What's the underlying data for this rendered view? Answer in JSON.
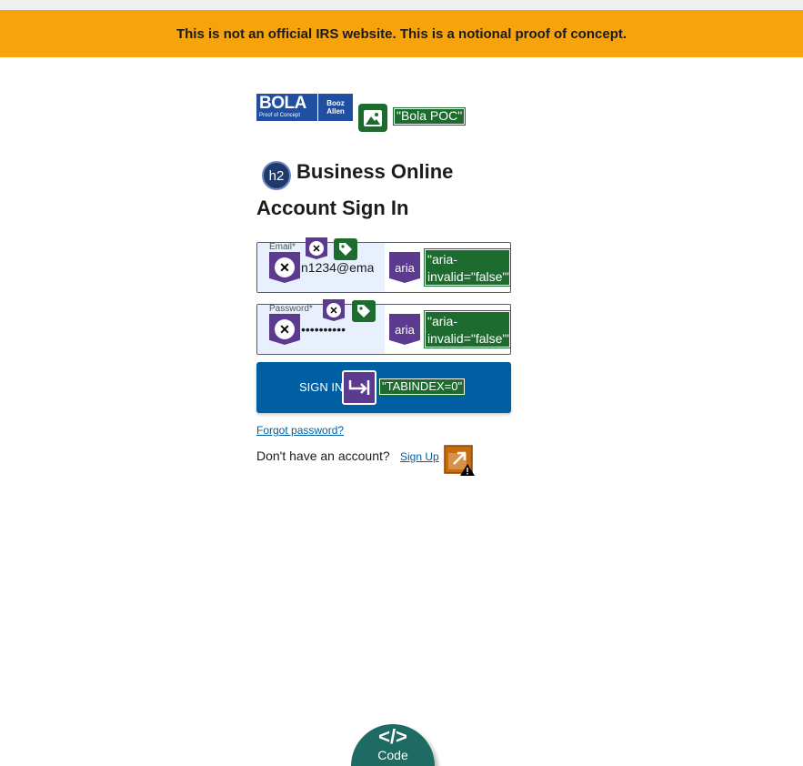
{
  "banner": {
    "text": "This is not an official IRS website. This is a notional proof of concept."
  },
  "logo": {
    "brand": "BOLA",
    "tagline": "Proof of Concept",
    "partner_line1": "Booz",
    "partner_line2": "Allen"
  },
  "logo_alt_tag": "\"Bola POC\"",
  "heading_badge": "h2",
  "app_title": "Business Online",
  "page_title": "Account Sign In",
  "email": {
    "label": "Email",
    "required_mark": "*",
    "value": "n1234@ema",
    "aria_badge": "aria",
    "aria_tag": "\"aria-invalid=\"false\"\""
  },
  "password": {
    "label": "Password",
    "required_mark": "*",
    "value": "••••••••••",
    "aria_badge": "aria",
    "aria_tag": "\"aria-invalid=\"false\"\""
  },
  "signin": {
    "label": "SIGN IN",
    "tabindex_tag": "\"TABINDEX=0\""
  },
  "forgot_password": "Forgot password?",
  "no_account_text": "Don't have an account?",
  "signup_link": "Sign Up",
  "code_toggle": {
    "glyph": "</>",
    "label": "Code"
  },
  "colors": {
    "banner": "#f7a30c",
    "primary": "#005ea2",
    "badge_purple": "#5b3a8f",
    "badge_green": "#1d6b2f",
    "code_tab": "#1d6b62"
  },
  "icons": [
    "image-icon",
    "heading-icon",
    "error-x-icon",
    "tag-icon",
    "aria-icon",
    "tabindex-icon",
    "new-window-warning-icon",
    "code-icon"
  ]
}
